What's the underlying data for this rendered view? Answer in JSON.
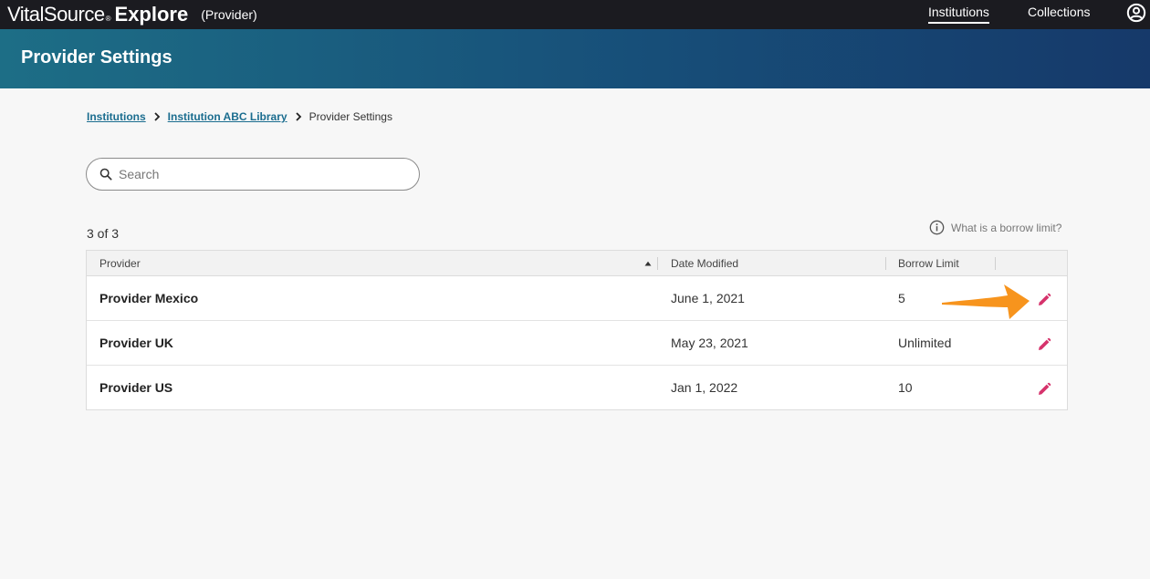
{
  "header": {
    "brand_name": "VitalSource",
    "brand_mark": "®",
    "brand_product": "Explore",
    "role": "(Provider)",
    "nav": [
      {
        "label": "Institutions",
        "active": true
      },
      {
        "label": "Collections",
        "active": false
      }
    ],
    "user_icon": "account-circle-icon"
  },
  "banner": {
    "title": "Provider Settings",
    "colors": [
      "#1d6e86",
      "#16396a"
    ]
  },
  "breadcrumb": [
    {
      "label": "Institutions",
      "link": true
    },
    {
      "label": "Institution ABC Library",
      "link": true
    },
    {
      "label": "Provider Settings",
      "link": false
    }
  ],
  "search": {
    "placeholder": "Search",
    "value": "",
    "icon": "search-icon"
  },
  "results": {
    "count_text": "3 of 3"
  },
  "help": {
    "label": "What is a borrow limit?",
    "icon": "info-icon"
  },
  "table": {
    "columns": [
      "Provider",
      "Date Modified",
      "Borrow Limit"
    ],
    "sort": {
      "column": "Provider",
      "direction": "ascending"
    },
    "rows": [
      {
        "provider": "Provider Mexico",
        "date": "June 1, 2021",
        "limit": "5"
      },
      {
        "provider": "Provider UK",
        "date": "May 23, 2021",
        "limit": "Unlimited"
      },
      {
        "provider": "Provider US",
        "date": "Jan 1, 2022",
        "limit": "10"
      }
    ],
    "edit_icon": "pencil-icon",
    "edit_color": "#d6336c"
  },
  "annotation": {
    "icon": "arrow-pointer-icon",
    "color": "#f7941d"
  }
}
